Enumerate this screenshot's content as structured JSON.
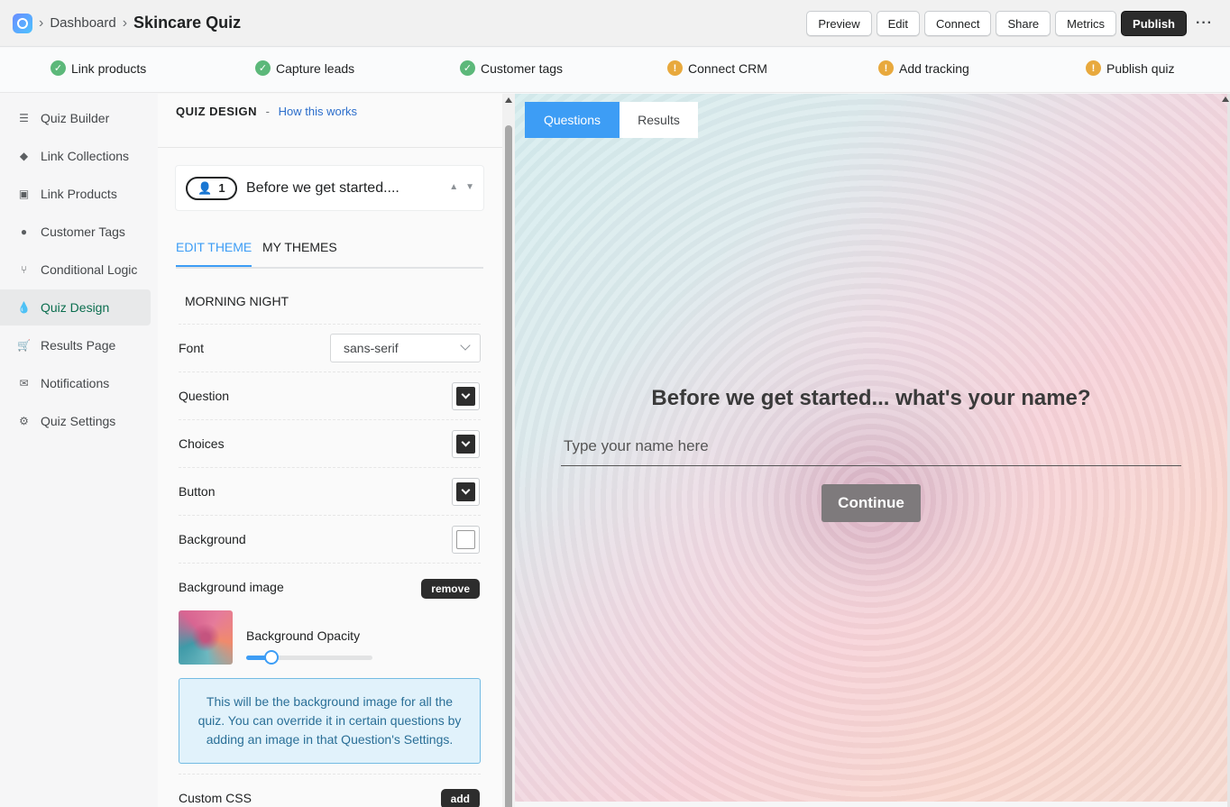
{
  "topbar": {
    "breadcrumb": "Dashboard",
    "title": "Skincare Quiz",
    "actions": [
      "Preview",
      "Edit",
      "Connect",
      "Share",
      "Metrics"
    ],
    "publish": "Publish",
    "more": "···"
  },
  "steps": [
    {
      "label": "Link products",
      "status": "done"
    },
    {
      "label": "Capture leads",
      "status": "done"
    },
    {
      "label": "Customer tags",
      "status": "done"
    },
    {
      "label": "Connect CRM",
      "status": "warning"
    },
    {
      "label": "Add tracking",
      "status": "warning"
    },
    {
      "label": "Publish quiz",
      "status": "warning"
    }
  ],
  "sidebar": {
    "items": [
      {
        "label": "Quiz Builder",
        "icon": "list-icon"
      },
      {
        "label": "Link Collections",
        "icon": "tag-icon"
      },
      {
        "label": "Link Products",
        "icon": "box-icon"
      },
      {
        "label": "Customer Tags",
        "icon": "person-icon"
      },
      {
        "label": "Conditional Logic",
        "icon": "branch-icon"
      },
      {
        "label": "Quiz Design",
        "icon": "drop-icon",
        "active": true
      },
      {
        "label": "Results Page",
        "icon": "cart-icon"
      },
      {
        "label": "Notifications",
        "icon": "envelope-icon"
      },
      {
        "label": "Quiz Settings",
        "icon": "gear-icon"
      }
    ]
  },
  "editor": {
    "heading": "QUIZ DESIGN",
    "separator": "-",
    "help_link": "How this works",
    "question": {
      "number": "1",
      "text": "Before we get started...."
    },
    "tabs": {
      "edit": "EDIT THEME",
      "mine": "MY THEMES"
    },
    "theme_name": "MORNING NIGHT",
    "font_label": "Font",
    "font_value": "sans-serif",
    "question_label": "Question",
    "choices_label": "Choices",
    "button_label": "Button",
    "background_label": "Background",
    "bg_image_label": "Background image",
    "remove_label": "remove",
    "opacity_label": "Background Opacity",
    "opacity_value": 0.2,
    "info": "This will be the background image for all the quiz. You can override it in certain questions by adding an image in that Question's Settings.",
    "custom_css_label": "Custom CSS",
    "add_label": "add",
    "colors": {
      "question": "#2d2d2d",
      "choices": "#2d2d2d",
      "button": "#2d2d2d",
      "background": "#ffffff"
    }
  },
  "preview": {
    "tabs": {
      "questions": "Questions",
      "results": "Results"
    },
    "question": "Before we get started... what's your name?",
    "input_placeholder": "Type your name here",
    "continue": "Continue"
  }
}
